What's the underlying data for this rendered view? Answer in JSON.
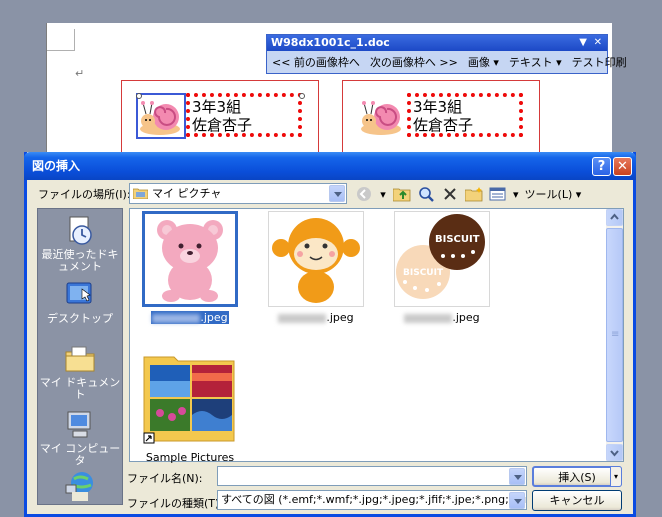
{
  "document": {
    "labels": [
      {
        "line1": "3年3組",
        "line2": "佐倉杏子"
      },
      {
        "line1": "3年3組",
        "line2": "佐倉杏子"
      }
    ],
    "para_mark": "↵"
  },
  "picture_toolbar": {
    "title": "W98dx1001c_1.doc",
    "buttons": [
      "<< 前の画像枠へ",
      "次の画像枠へ >>",
      "画像 ▾",
      "テキスト ▾",
      "テスト印刷"
    ]
  },
  "dialog": {
    "title": "図の挿入",
    "look_in_label": "ファイルの場所(I):",
    "look_in_value": "マイ ピクチャ",
    "tools_label": "ツール(L) ▾",
    "places": [
      {
        "label": "最近使ったドキュメント",
        "icon": "recent-documents-icon"
      },
      {
        "label": "デスクトップ",
        "icon": "desktop-icon"
      },
      {
        "label": "マイ ドキュメント",
        "icon": "my-documents-icon"
      },
      {
        "label": "マイ コンピュータ",
        "icon": "my-computer-icon"
      },
      {
        "label": "",
        "icon": "network-icon"
      }
    ],
    "files": [
      {
        "ext": ".jpeg",
        "selected": true
      },
      {
        "ext": ".jpeg",
        "selected": false
      },
      {
        "ext": ".jpeg",
        "selected": false
      },
      {
        "name": "Sample Pictures",
        "selected": false
      }
    ],
    "file_name_label": "ファイル名(N):",
    "file_name_value": "",
    "file_type_label": "ファイルの種類(T):",
    "file_type_value": "すべての図 (*.emf;*.wmf;*.jpg;*.jpeg;*.jfif;*.jpe;*.png;*.bmp;*",
    "insert_label": "挿入(S)",
    "cancel_label": "キャンセル",
    "biscuit_text": "BISCUIT"
  },
  "colors": {
    "title_bar": "#0a4ed9",
    "selection": "#316ac5",
    "label_border": "#d53a3a",
    "dotted": "#ee0a0a"
  }
}
